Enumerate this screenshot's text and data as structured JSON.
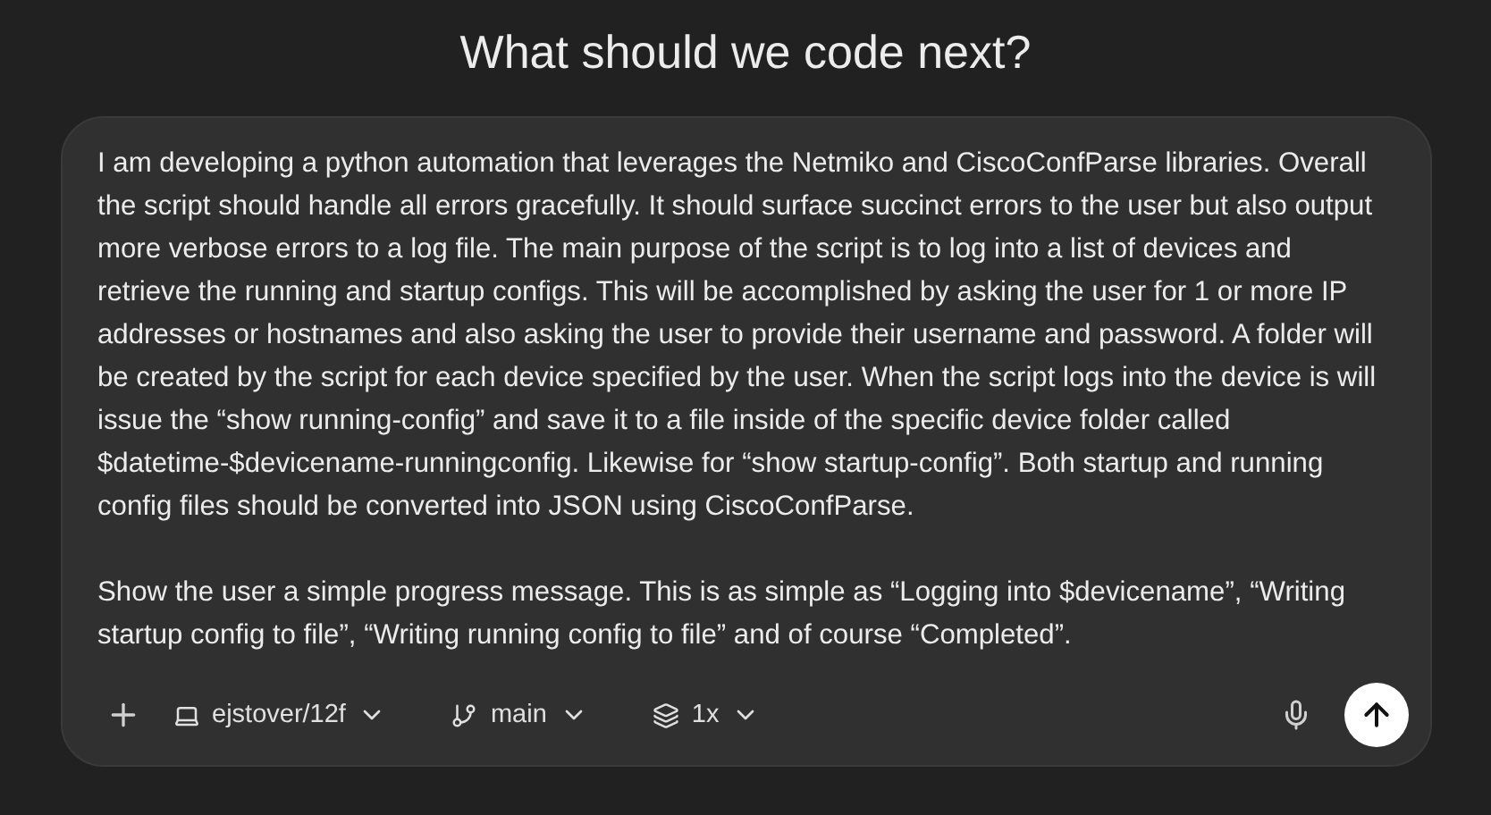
{
  "heading": "What should we code next?",
  "prompt": {
    "paragraphs": [
      "I am developing a python automation that leverages the Netmiko and CiscoConfParse libraries. Overall the script should handle all errors gracefully. It should surface succinct errors to the user but also output more verbose errors to a log file. The main purpose of the script is to log into a list of devices and retrieve the running and startup configs. This will be accomplished by asking the user for 1 or more IP addresses or hostnames and also asking the user to provide their username and password. A folder will be created by the script for each device specified by the user. When the script logs into the device is will issue the “show running-config” and save it to a file inside of the specific device folder called $datetime-$devicename-runningconfig. Likewise for “show startup-config”. Both startup and running config files should be converted into JSON using CiscoConfParse.",
      "Show the user a simple progress message. This is as simple as “Logging into $devicename”, “Writing startup config to file”, “Writing running config to file” and of course “Completed”."
    ]
  },
  "toolbar": {
    "selectors": [
      {
        "kind": "environment",
        "label": "ejstover/12f"
      },
      {
        "kind": "branch",
        "label": "main"
      },
      {
        "kind": "versions",
        "label": "1x"
      }
    ]
  }
}
